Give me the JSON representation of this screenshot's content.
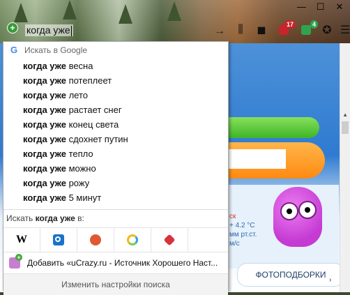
{
  "urlbar": {
    "typed_text": "когда уже",
    "plus_icon": "add-search-engine-icon",
    "go_icon": "go-arrow-icon"
  },
  "toolbar": {
    "badges": [
      {
        "name": "notifications-badge",
        "value": "17",
        "color": "#c9232d"
      },
      {
        "name": "mail-badge",
        "value": "4",
        "color": "#2fa44f"
      }
    ]
  },
  "dropdown": {
    "header_label": "Искать в Google",
    "header_icon": "google-icon",
    "suggestions": [
      {
        "bold": "когда уже",
        "rest": " весна"
      },
      {
        "bold": "когда уже",
        "rest": " потеплеет"
      },
      {
        "bold": "когда уже",
        "rest": " лето"
      },
      {
        "bold": "когда уже",
        "rest": " растает снег"
      },
      {
        "bold": "когда уже",
        "rest": " конец света"
      },
      {
        "bold": "когда уже",
        "rest": " сдохнет путин"
      },
      {
        "bold": "когда уже",
        "rest": " тепло"
      },
      {
        "bold": "когда уже",
        "rest": " можно"
      },
      {
        "bold": "когда уже",
        "rest": " рожу"
      },
      {
        "bold": "когда уже",
        "rest": " 5 минут"
      }
    ],
    "search_with_prefix": "Искать",
    "search_with_query": "когда уже",
    "search_with_suffix": "в:",
    "engines": [
      {
        "name": "wikipedia",
        "icon": "wikipedia-icon",
        "glyph": "W"
      },
      {
        "name": "mail-search",
        "icon": "search-engine-blue-icon",
        "color": "#1a73c9"
      },
      {
        "name": "duckduckgo",
        "icon": "duckduckgo-icon",
        "color": "#de5833"
      },
      {
        "name": "yandex",
        "icon": "rainbow-ring-icon",
        "color": "#f2b91a"
      },
      {
        "name": "gift",
        "icon": "gift-box-icon",
        "color": "#d8323a"
      }
    ],
    "add_engine_label": "Добавить «uCrazy.ru - Источник Хорошего Наст...",
    "settings_label": "Изменить настройки поиска"
  },
  "page": {
    "weather_line1": "ск",
    "weather_line2": "+ 4.2 °C",
    "weather_line3": "мм рт.ст.",
    "weather_line4": "м/с",
    "tab_label": "ФОТОПОДБОРКИ"
  }
}
